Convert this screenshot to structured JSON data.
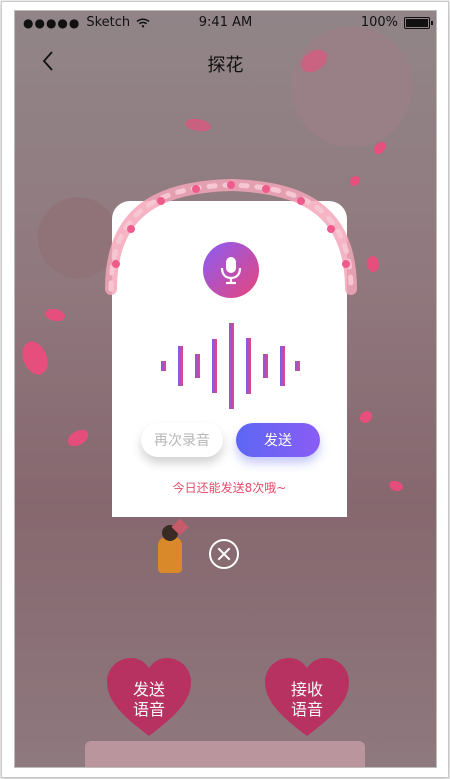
{
  "status_bar": {
    "carrier": "Sketch",
    "time": "9:41 AM",
    "battery": "100%"
  },
  "nav": {
    "title": "探花"
  },
  "dialog": {
    "rerecord_label": "再次录音",
    "send_label": "发送",
    "remaining_text": "今日还能发送8次哦~"
  },
  "actions": {
    "send_voice": [
      "发送",
      "语音"
    ],
    "receive_voice": [
      "接收",
      "语音"
    ]
  },
  "icons": [
    "back-icon",
    "microphone-icon",
    "close-icon",
    "wifi-icon",
    "battery-icon"
  ],
  "colors": {
    "accent_gradient_start": "#5d67f4",
    "accent_gradient_end": "#8a5cf5",
    "mic_gradient_end": "#e8457a",
    "remaining_text": "#e84a6a",
    "heart": "#b83261"
  }
}
